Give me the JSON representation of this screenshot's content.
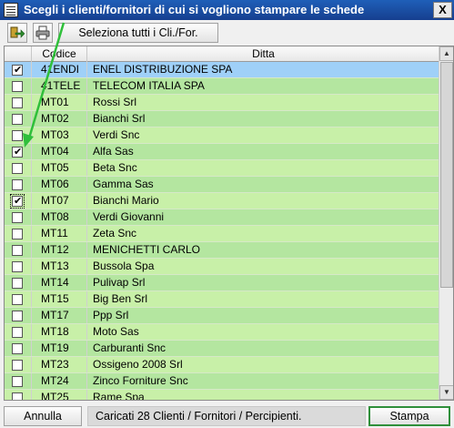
{
  "window": {
    "title": "Scegli i clienti/fornitori di cui si vogliono stampare le schede",
    "close_label": "X"
  },
  "toolbar": {
    "export_icon": "export-icon",
    "print_icon": "printer-icon",
    "select_all_label": "Seleziona tutti i Cli./For."
  },
  "grid": {
    "columns": {
      "code": "Codice",
      "name": "Ditta"
    },
    "rows": [
      {
        "code": "41ENDI",
        "name": "ENEL DISTRIBUZIONE SPA",
        "checked": true
      },
      {
        "code": "41TELE",
        "name": "TELECOM ITALIA SPA",
        "checked": false
      },
      {
        "code": "MT01",
        "name": "Rossi Srl",
        "checked": false
      },
      {
        "code": "MT02",
        "name": "Bianchi Srl",
        "checked": false
      },
      {
        "code": "MT03",
        "name": "Verdi Snc",
        "checked": false
      },
      {
        "code": "MT04",
        "name": "Alfa Sas",
        "checked": true
      },
      {
        "code": "MT05",
        "name": "Beta Snc",
        "checked": false
      },
      {
        "code": "MT06",
        "name": "Gamma Sas",
        "checked": false
      },
      {
        "code": "MT07",
        "name": "Bianchi Mario",
        "checked": true
      },
      {
        "code": "MT08",
        "name": "Verdi Giovanni",
        "checked": false
      },
      {
        "code": "MT11",
        "name": "Zeta Snc",
        "checked": false
      },
      {
        "code": "MT12",
        "name": "MENICHETTI  CARLO",
        "checked": false
      },
      {
        "code": "MT13",
        "name": "Bussola Spa",
        "checked": false
      },
      {
        "code": "MT14",
        "name": "Pulivap Srl",
        "checked": false
      },
      {
        "code": "MT15",
        "name": "Big Ben Srl",
        "checked": false
      },
      {
        "code": "MT17",
        "name": "Ppp Srl",
        "checked": false
      },
      {
        "code": "MT18",
        "name": "Moto Sas",
        "checked": false
      },
      {
        "code": "MT19",
        "name": "Carburanti Snc",
        "checked": false
      },
      {
        "code": "MT23",
        "name": "Ossigeno 2008 Srl",
        "checked": false
      },
      {
        "code": "MT24",
        "name": "Zinco Forniture Snc",
        "checked": false
      },
      {
        "code": "MT25",
        "name": "Rame Spa",
        "checked": false
      }
    ]
  },
  "footer": {
    "cancel_label": "Annulla",
    "status_text": "Caricati 28 Clienti / Fornitori / Percipienti.",
    "print_label": "Stampa"
  },
  "colors": {
    "row_light": "#c8f0a8",
    "row_dark": "#b4e6a0",
    "row_selected": "#9fd0f8",
    "annotation_arrow": "#2fbf3a"
  }
}
